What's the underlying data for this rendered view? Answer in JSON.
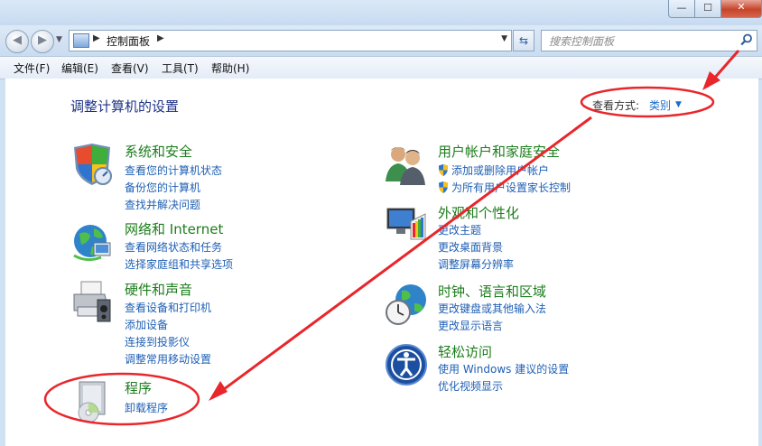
{
  "window": {
    "minimize": "—",
    "maximize": "☐",
    "close": "✕"
  },
  "nav": {
    "back": "◀",
    "forward": "▶",
    "address": "控制面板",
    "search_placeholder": "搜索控制面板"
  },
  "menu": [
    "文件(F)",
    "编辑(E)",
    "查看(V)",
    "工具(T)",
    "帮助(H)"
  ],
  "page": {
    "title": "调整计算机的设置",
    "view_by_label": "查看方式:",
    "view_by_value": "类别"
  },
  "categories": [
    {
      "title": "系统和安全",
      "icon": "shield-icon",
      "links": [
        "查看您的计算机状态",
        "备份您的计算机",
        "查找并解决问题"
      ]
    },
    {
      "title": "网络和 Internet",
      "icon": "network-icon",
      "links": [
        "查看网络状态和任务",
        "选择家庭组和共享选项"
      ]
    },
    {
      "title": "硬件和声音",
      "icon": "printer-icon",
      "links": [
        "查看设备和打印机",
        "添加设备",
        "连接到投影仪",
        "调整常用移动设置"
      ]
    },
    {
      "title": "程序",
      "icon": "programs-icon",
      "links": [
        "卸载程序"
      ]
    },
    {
      "title": "用户帐户和家庭安全",
      "icon": "users-icon",
      "links": [
        "添加或删除用户帐户",
        "为所有用户设置家长控制"
      ]
    },
    {
      "title": "外观和个性化",
      "icon": "appearance-icon",
      "links": [
        "更改主题",
        "更改桌面背景",
        "调整屏幕分辨率"
      ]
    },
    {
      "title": "时钟、语言和区域",
      "icon": "clock-globe-icon",
      "links": [
        "更改键盘或其他输入法",
        "更改显示语言"
      ]
    },
    {
      "title": "轻松访问",
      "icon": "ease-of-access-icon",
      "links": [
        "使用 Windows 建议的设置",
        "优化视频显示"
      ]
    }
  ],
  "colors": {
    "category_title": "#1b7d1b",
    "link": "#1e5fb4",
    "page_title": "#1e3287",
    "annotation": "#e8262b"
  }
}
